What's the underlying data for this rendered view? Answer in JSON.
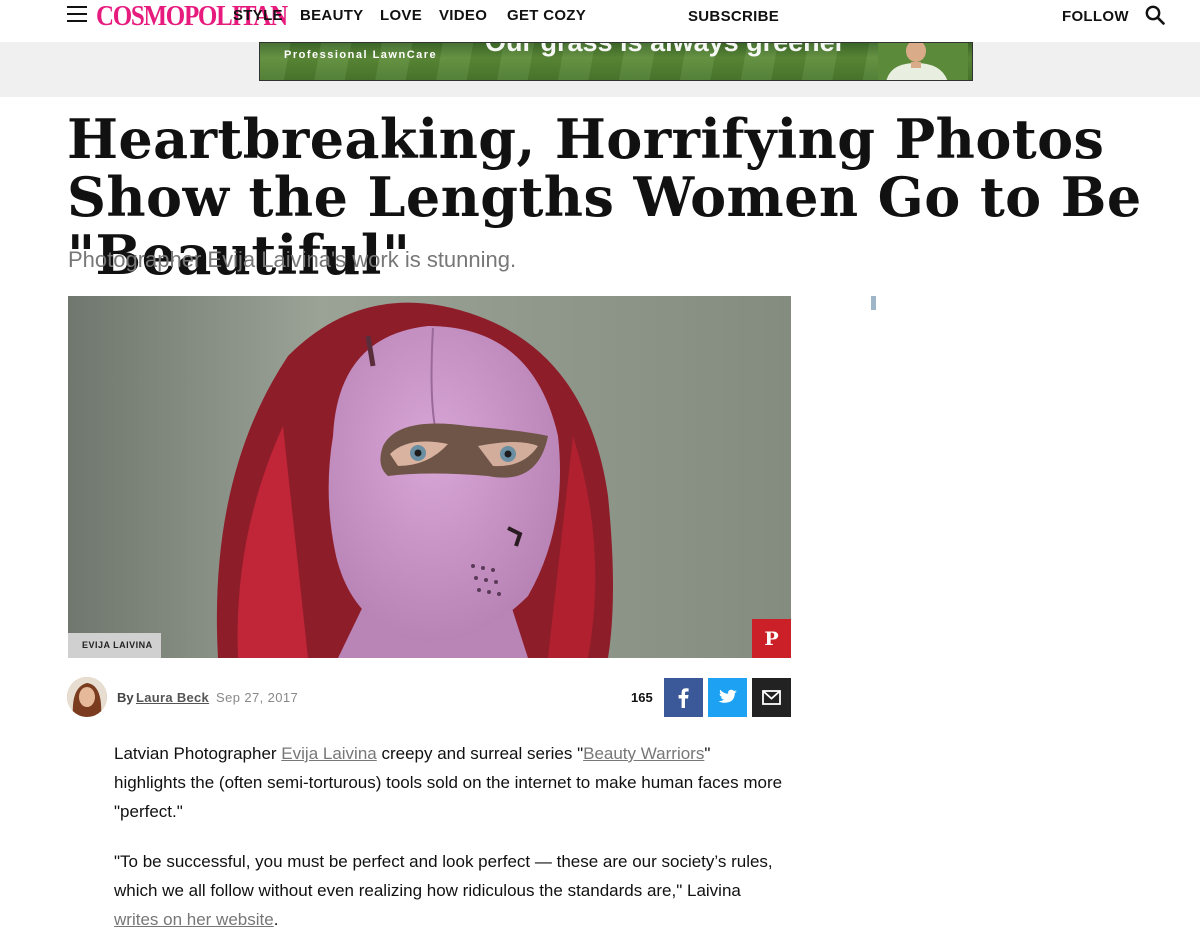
{
  "nav": {
    "logo": "COSMOPOLITAN",
    "items": [
      "STYLE",
      "BEAUTY",
      "LOVE",
      "VIDEO",
      "GET COZY"
    ],
    "subscribe": "SUBSCRIBE",
    "follow": "FOLLOW"
  },
  "ad": {
    "brand": "Professional LawnCare",
    "slogan": "Our grass is always greener"
  },
  "article": {
    "headline": "Heartbreaking, Horrifying Photos Show the Lengths Women Go to Be \"Beautiful\"",
    "dek": "Photographer Evija Laivina's work is stunning.",
    "photo_credit": "EVIJA LAIVINA",
    "byline_prefix": "By",
    "author": "Laura Beck",
    "date": "Sep 27, 2017",
    "share_count": "165",
    "paragraphs": [
      {
        "t1": "Latvian Photographer ",
        "link1": "Evija Laivina",
        "t2": " creepy and surreal series \"",
        "link2": "Beauty Warriors",
        "t3": "\" highlights the (often semi-torturous) tools sold on the internet to make human faces more \"perfect.\""
      },
      {
        "t1": "\"To be successful, you must be perfect and look perfect — these are our society’s rules, which we all follow without even realizing how ridiculous the standards are,\" Laivina ",
        "link1": "writes on her website",
        "t2": "."
      }
    ]
  },
  "colors": {
    "brand_pink": "#e71b7e",
    "pinterest": "#cb2027",
    "facebook": "#3b5998",
    "twitter": "#1da1f2"
  },
  "icons": [
    "menu-icon",
    "search-icon",
    "pinterest-icon",
    "facebook-icon",
    "twitter-icon",
    "email-icon"
  ]
}
